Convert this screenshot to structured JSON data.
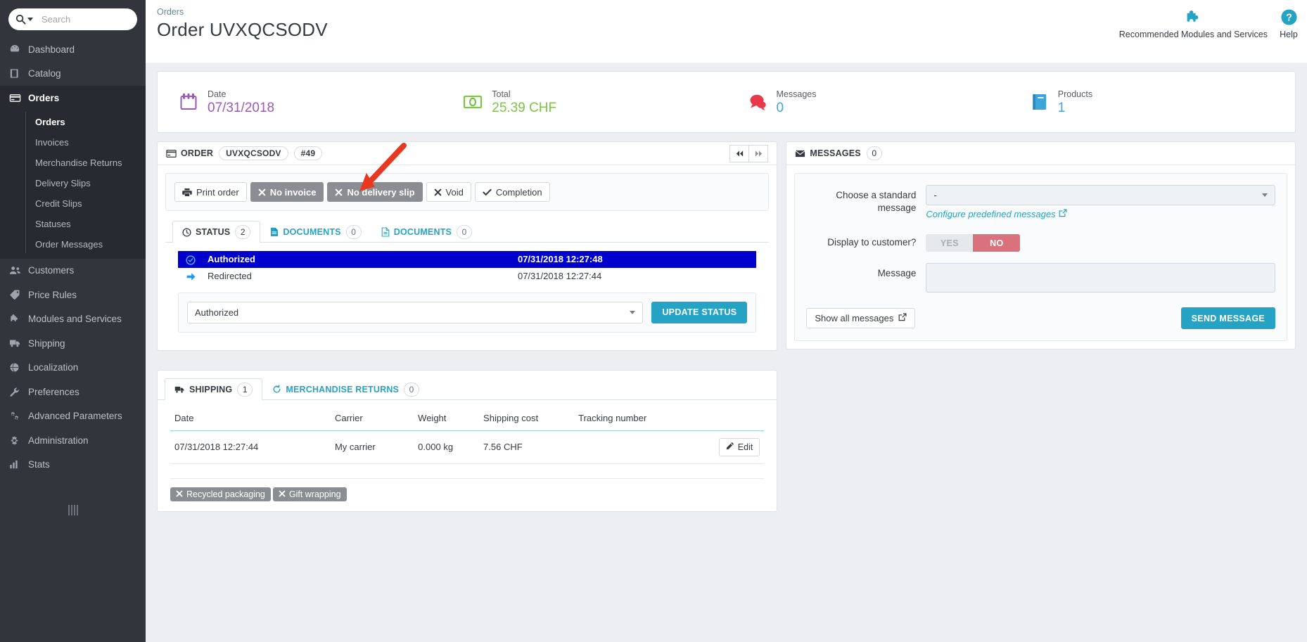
{
  "sidebar": {
    "search": {
      "placeholder": "Search",
      "value": ""
    },
    "items": [
      {
        "label": "Dashboard",
        "icon": "dashboard-icon",
        "active": false
      },
      {
        "label": "Catalog",
        "icon": "catalog-icon",
        "active": false
      },
      {
        "label": "Orders",
        "icon": "orders-icon",
        "active": true
      },
      {
        "label": "Customers",
        "icon": "customers-icon",
        "active": false
      },
      {
        "label": "Price Rules",
        "icon": "tag-icon",
        "active": false
      },
      {
        "label": "Modules and Services",
        "icon": "puzzle-icon",
        "active": false
      },
      {
        "label": "Shipping",
        "icon": "truck-icon",
        "active": false
      },
      {
        "label": "Localization",
        "icon": "globe-icon",
        "active": false
      },
      {
        "label": "Preferences",
        "icon": "wrench-icon",
        "active": false
      },
      {
        "label": "Advanced Parameters",
        "icon": "gears-icon",
        "active": false
      },
      {
        "label": "Administration",
        "icon": "gear-icon",
        "active": false
      },
      {
        "label": "Stats",
        "icon": "stats-icon",
        "active": false
      }
    ],
    "submenu": [
      {
        "label": "Orders",
        "active": true
      },
      {
        "label": "Invoices",
        "active": false
      },
      {
        "label": "Merchandise Returns",
        "active": false
      },
      {
        "label": "Delivery Slips",
        "active": false
      },
      {
        "label": "Credit Slips",
        "active": false
      },
      {
        "label": "Statuses",
        "active": false
      },
      {
        "label": "Order Messages",
        "active": false
      }
    ]
  },
  "header": {
    "breadcrumb": "Orders",
    "title": "Order UVXQCSODV",
    "actions": [
      {
        "label": "Recommended Modules and Services",
        "icon": "puzzle-icon"
      },
      {
        "label": "Help",
        "icon": "question-circle-icon"
      }
    ]
  },
  "kpis": [
    {
      "label": "Date",
      "value": "07/31/2018",
      "icon": "calendar-icon",
      "color": "#9b59b6"
    },
    {
      "label": "Total",
      "value": "25.39 CHF",
      "icon": "money-icon",
      "color": "#7fc34b"
    },
    {
      "label": "Messages",
      "value": "0",
      "icon": "comments-icon",
      "color": "#3da5d9"
    },
    {
      "label": "Products",
      "value": "1",
      "icon": "book-icon",
      "color": "#3da5d9"
    }
  ],
  "order_panel": {
    "title": "ORDER",
    "reference": "UVXQCSODV",
    "number": "#49",
    "nav_prev": "◀◀",
    "nav_next": "▶▶",
    "toolbar": [
      {
        "label": "Print order",
        "icon": "printer-icon",
        "style": "default"
      },
      {
        "label": "No invoice",
        "icon": "times-icon",
        "style": "disabled"
      },
      {
        "label": "No delivery slip",
        "icon": "times-icon",
        "style": "disabled"
      },
      {
        "label": "Void",
        "icon": "times-icon",
        "style": "default"
      },
      {
        "label": "Completion",
        "icon": "check-icon",
        "style": "default"
      }
    ],
    "tabs": [
      {
        "label": "STATUS",
        "count": "2",
        "icon": "clock-icon",
        "active": true
      },
      {
        "label": "DOCUMENTS",
        "count": "0",
        "icon": "file-icon",
        "active": false
      },
      {
        "label": "DOCUMENTS",
        "count": "0",
        "icon": "file-alt-icon",
        "active": false
      }
    ],
    "status_rows": [
      {
        "icon": "check-circle-icon",
        "label": "Authorized",
        "date": "07/31/2018 12:27:48",
        "highlight": true
      },
      {
        "icon": "arrow-right-icon",
        "label": "Redirected",
        "date": "07/31/2018 12:27:44",
        "highlight": false
      }
    ],
    "status_select": {
      "value": "Authorized"
    },
    "update_status_label": "UPDATE STATUS"
  },
  "shipping_panel": {
    "tabs": [
      {
        "label": "SHIPPING",
        "count": "1",
        "icon": "truck-icon",
        "active": true
      },
      {
        "label": "MERCHANDISE RETURNS",
        "count": "0",
        "icon": "refresh-icon",
        "active": false
      }
    ],
    "columns": [
      "Date",
      "Carrier",
      "Weight",
      "Shipping cost",
      "Tracking number",
      ""
    ],
    "rows": [
      {
        "date": "07/31/2018 12:27:44",
        "carrier": "My carrier",
        "weight": "0.000 kg",
        "shipping_cost": "7.56 CHF",
        "tracking": "",
        "edit_label": "Edit"
      }
    ],
    "flags": [
      {
        "label": "Recycled packaging",
        "icon": "times-icon"
      },
      {
        "label": "Gift wrapping",
        "icon": "times-icon"
      }
    ]
  },
  "messages_panel": {
    "title": "MESSAGES",
    "count": "0",
    "standard_message_label": "Choose a standard message",
    "standard_message_value": "-",
    "configure_link": "Configure predefined messages",
    "display_label": "Display to customer?",
    "toggle_yes": "YES",
    "toggle_no": "NO",
    "toggle_state": "NO",
    "message_label": "Message",
    "message_value": "",
    "show_all_label": "Show all messages",
    "send_label": "SEND MESSAGE"
  },
  "annotation": {
    "arrow_color": "#e8381f",
    "points_to": "Void"
  },
  "colors": {
    "sidebar_bg": "#32353c",
    "sidebar_active": "#272a30",
    "accent": "#25a3c4",
    "content_bg": "#eceef1",
    "highlight_row": "#0000cc",
    "danger": "#d9727d",
    "muted_btn": "#8a8d92"
  }
}
